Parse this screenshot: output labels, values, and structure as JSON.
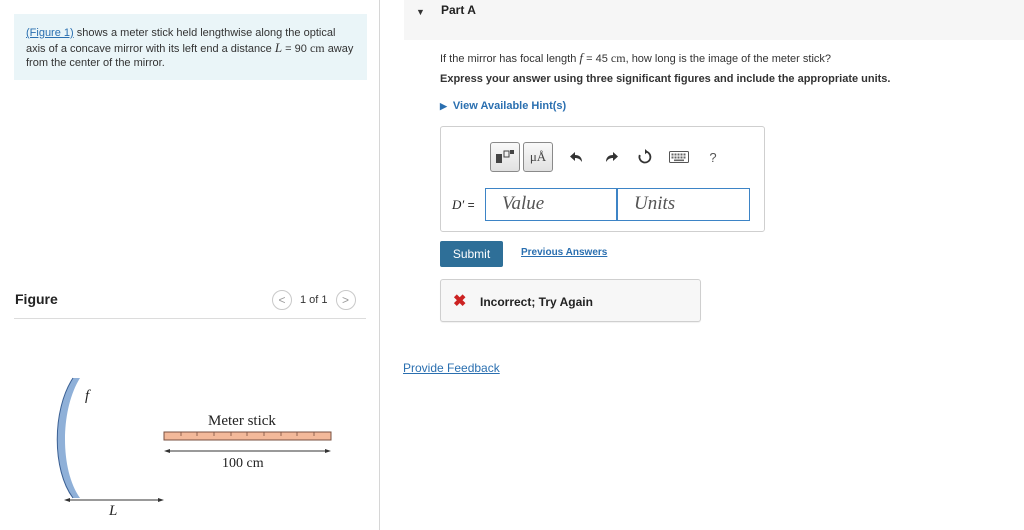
{
  "problem": {
    "figure_link": "(Figure 1)",
    "text_before_var": "shows a meter stick held lengthwise along the optical axis of a concave mirror with its left end a distance",
    "var_name": "L",
    "equals": "=",
    "value_text": "90",
    "unit": "cm",
    "text_after": "away from the center of the mirror."
  },
  "figure": {
    "title": "Figure",
    "pager_count": "1 of 1",
    "prev_symbol": "<",
    "next_symbol": ">",
    "label_f": "f",
    "label_meter_stick": "Meter stick",
    "label_length": "100 cm",
    "label_L": "L"
  },
  "part": {
    "title": "Part A",
    "question_before": "If the mirror has focal length",
    "question_var": "f",
    "question_equals": "=",
    "question_value": "45",
    "question_unit": "cm",
    "question_after": ", how long is the image of the meter stick?",
    "instruction": "Express your answer using three significant figures and include the appropriate units.",
    "hints_label": "View Available Hint(s)"
  },
  "answer": {
    "label_var": "D′",
    "label_equals": "=",
    "value_placeholder": "Value",
    "units_placeholder": "Units"
  },
  "toolbar": {
    "units_button_label": "μÅ",
    "help_label": "?",
    "icons": [
      "template-icon",
      "units-icon",
      "undo-icon",
      "redo-icon",
      "reset-icon",
      "keyboard-icon",
      "help-icon"
    ]
  },
  "actions": {
    "submit_label": "Submit",
    "previous_answers_label": "Previous Answers",
    "provide_feedback_label": "Provide Feedback"
  },
  "feedback": {
    "icon_symbol": "✖",
    "message": "Incorrect; Try Again",
    "status_color": "#cc2222"
  },
  "colors": {
    "accent_link": "#2a6fb0",
    "submit_bg": "#2e6f98",
    "intro_bg": "#eaf5f8",
    "input_border": "#3d84c6",
    "stick_fill": "#f3b99a",
    "mirror": "#8fb0d8"
  }
}
